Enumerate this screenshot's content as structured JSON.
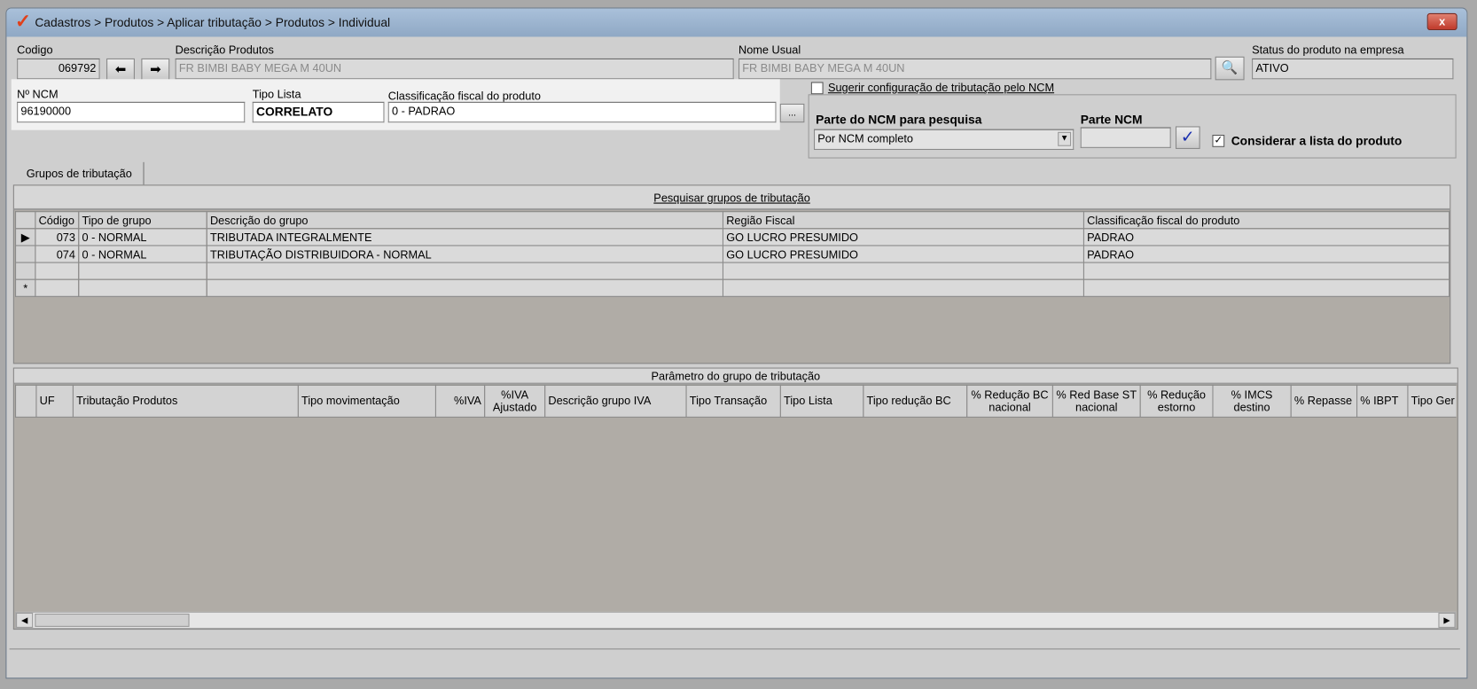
{
  "window": {
    "title": "Cadastros > Produtos > Aplicar tributação > Produtos > Individual",
    "close": "x"
  },
  "product": {
    "codigo_label": "Codigo",
    "codigo": "069792",
    "descricao_label": "Descrição  Produtos",
    "descricao": "FR BIMBI BABY MEGA M 40UN",
    "nome_usual_label": "Nome Usual",
    "nome_usual": "FR BIMBI BABY MEGA M 40UN",
    "status_label": "Status do produto na empresa",
    "status": "ATIVO",
    "ncm_label": "Nº NCM",
    "ncm": "96190000",
    "tipo_lista_label": "Tipo Lista",
    "tipo_lista": "CORRELATO",
    "classificacao_label": "Classificação fiscal do produto",
    "classificacao": "0 - PADRAO",
    "ellipsis": "..."
  },
  "ncm_search": {
    "suggest_label": "Sugerir configuração de tributação pelo NCM",
    "suggest_checked": false,
    "parte_label": "Parte do NCM para pesquisa",
    "parte_value": "Por NCM completo",
    "parte_ncm_label": "Parte NCM",
    "parte_ncm_value": "",
    "considerar_label": "Considerar a lista do produto",
    "considerar_checked": true
  },
  "tabs": [
    {
      "label": "Grupos de tributação"
    }
  ],
  "groups_grid": {
    "title": "Pesquisar grupos de tributação",
    "columns": [
      "Código",
      "Tipo de grupo",
      "Descrição do grupo",
      "Região Fiscal",
      "Classificação fiscal do produto"
    ],
    "rows": [
      [
        "073",
        "0 - NORMAL",
        "TRIBUTADA INTEGRALMENTE",
        "GO LUCRO PRESUMIDO",
        "PADRAO"
      ],
      [
        "074",
        "0 - NORMAL",
        "TRIBUTAÇÃO DISTRIBUIDORA - NORMAL",
        "GO LUCRO PRESUMIDO",
        "PADRAO"
      ]
    ]
  },
  "params_grid": {
    "title": "Parâmetro do grupo de tributação",
    "columns": [
      "UF",
      "Tributação Produtos",
      "Tipo movimentação",
      "%IVA",
      "%IVA Ajustado",
      "Descrição grupo IVA",
      "Tipo Transação",
      "Tipo Lista",
      "Tipo redução BC",
      "% Redução BC nacional",
      "% Red Base ST nacional",
      "% Redução estorno",
      "% IMCS destino",
      "% Repasse",
      "% IBPT",
      "Tipo Ger"
    ]
  }
}
